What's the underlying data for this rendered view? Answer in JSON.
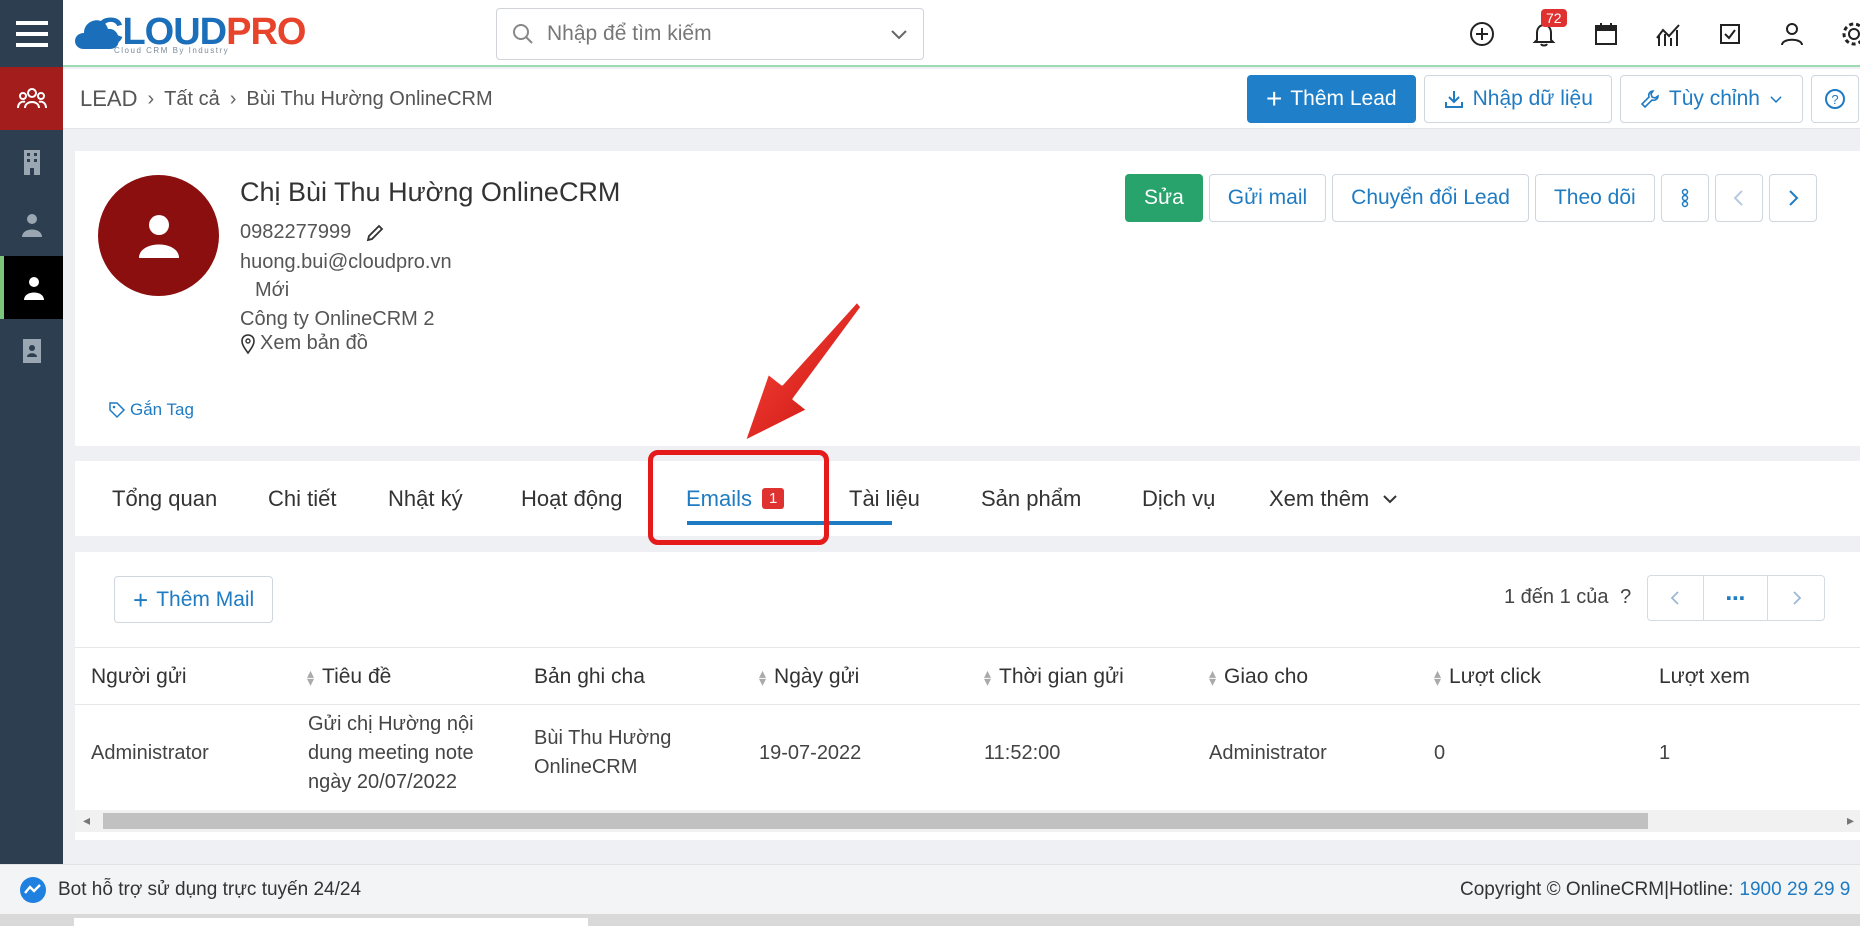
{
  "app": {
    "logo_main": "CLOUD",
    "logo_accent": "PRO",
    "logo_tagline": "Cloud CRM By Industry"
  },
  "search": {
    "placeholder": "Nhập để tìm kiếm"
  },
  "notifications": {
    "count": "72"
  },
  "breadcrumb": {
    "module": "LEAD",
    "level1": "Tất cả",
    "level2": "Bùi Thu Hường OnlineCRM"
  },
  "toolbar": {
    "add_lead": "Thêm Lead",
    "import": "Nhập dữ liệu",
    "customize": "Tùy chỉnh"
  },
  "lead": {
    "name": "Chị Bùi Thu Hường OnlineCRM",
    "phone": "0982277999",
    "email": "huong.bui@cloudpro.vn",
    "status": "Mới",
    "company": "Công ty OnlineCRM 2",
    "map_link": "Xem bản đồ",
    "tag_link": "Gắn Tag"
  },
  "record_actions": {
    "edit": "Sửa",
    "send_mail": "Gửi mail",
    "convert": "Chuyển đổi Lead",
    "follow": "Theo dõi"
  },
  "tabs": [
    {
      "label": "Tổng quan"
    },
    {
      "label": "Chi tiết"
    },
    {
      "label": "Nhật ký"
    },
    {
      "label": "Hoạt động"
    },
    {
      "label": "Emails",
      "badge": "1"
    },
    {
      "label": "Tài liệu"
    },
    {
      "label": "Sản phẩm"
    },
    {
      "label": "Dịch vụ"
    },
    {
      "label": "Xem thêm"
    }
  ],
  "emails_panel": {
    "add_mail": "Thêm Mail",
    "pager_text": "1 đến 1 của",
    "pager_help": "?",
    "columns": [
      "Người gửi",
      "Tiêu đề",
      "Bản ghi cha",
      "Ngày gửi",
      "Thời gian gửi",
      "Giao cho",
      "Lượt click",
      "Lượt xem"
    ],
    "rows": [
      {
        "sender": "Administrator",
        "subject_l1": "Gửi chị Hường nội",
        "subject_l2": "dung meeting note",
        "subject_l3": "ngày 20/07/2022",
        "parent_l1": "Bùi Thu Hường",
        "parent_l2": "OnlineCRM",
        "date": "19-07-2022",
        "time": "11:52:00",
        "assignee": "Administrator",
        "clicks": "0",
        "views": "1"
      }
    ]
  },
  "footer": {
    "bot_text": "Bot hỗ trợ sử dụng trực tuyến 24/24",
    "copyright": "Copyright © OnlineCRM|Hotline:",
    "hotline": "1900 29 29 9"
  },
  "colors": {
    "primary": "#1f80c9",
    "green": "#27a36b",
    "brand_red": "#a31d1d",
    "highlight": "#e51b1b"
  }
}
